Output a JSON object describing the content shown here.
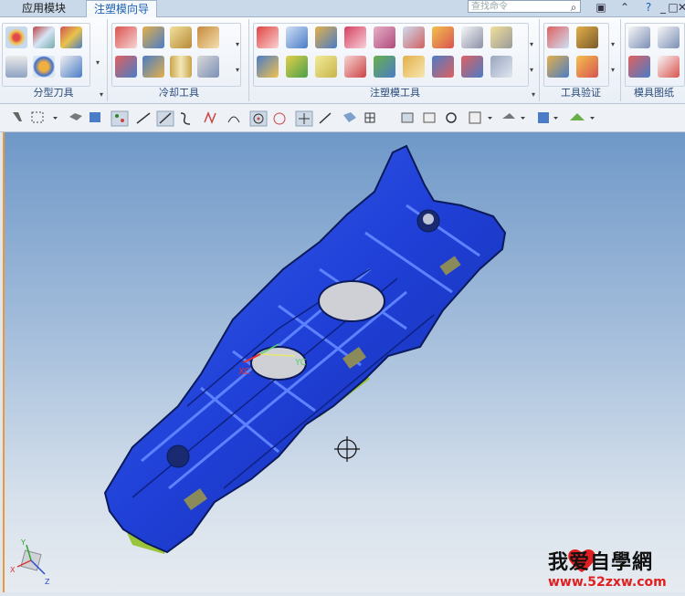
{
  "tabs": [
    {
      "label": "应用模块",
      "active": false
    },
    {
      "label": "注塑模向导",
      "active": true
    }
  ],
  "search": {
    "placeholder": "查找命令"
  },
  "window_controls": [
    "search-icon",
    "window-icon",
    "chevron-up-icon",
    "help-icon",
    "minimize-icon",
    "restore-icon",
    "close-icon"
  ],
  "ribbon_groups": [
    {
      "label": "分型刀具"
    },
    {
      "label": "冷却工具"
    },
    {
      "label": "注塑模工具"
    },
    {
      "label": "工具验证"
    },
    {
      "label": "模具图纸"
    }
  ],
  "watermark": {
    "main": "我爱自學網",
    "url": "www.52zxw.com"
  },
  "colors": {
    "accent": "#1b5fb0",
    "part_blue": "#1f3fd6",
    "part_green": "#9ac43a",
    "viewport_top": "#6f98c8",
    "viewport_bottom": "#e6ebf0"
  }
}
